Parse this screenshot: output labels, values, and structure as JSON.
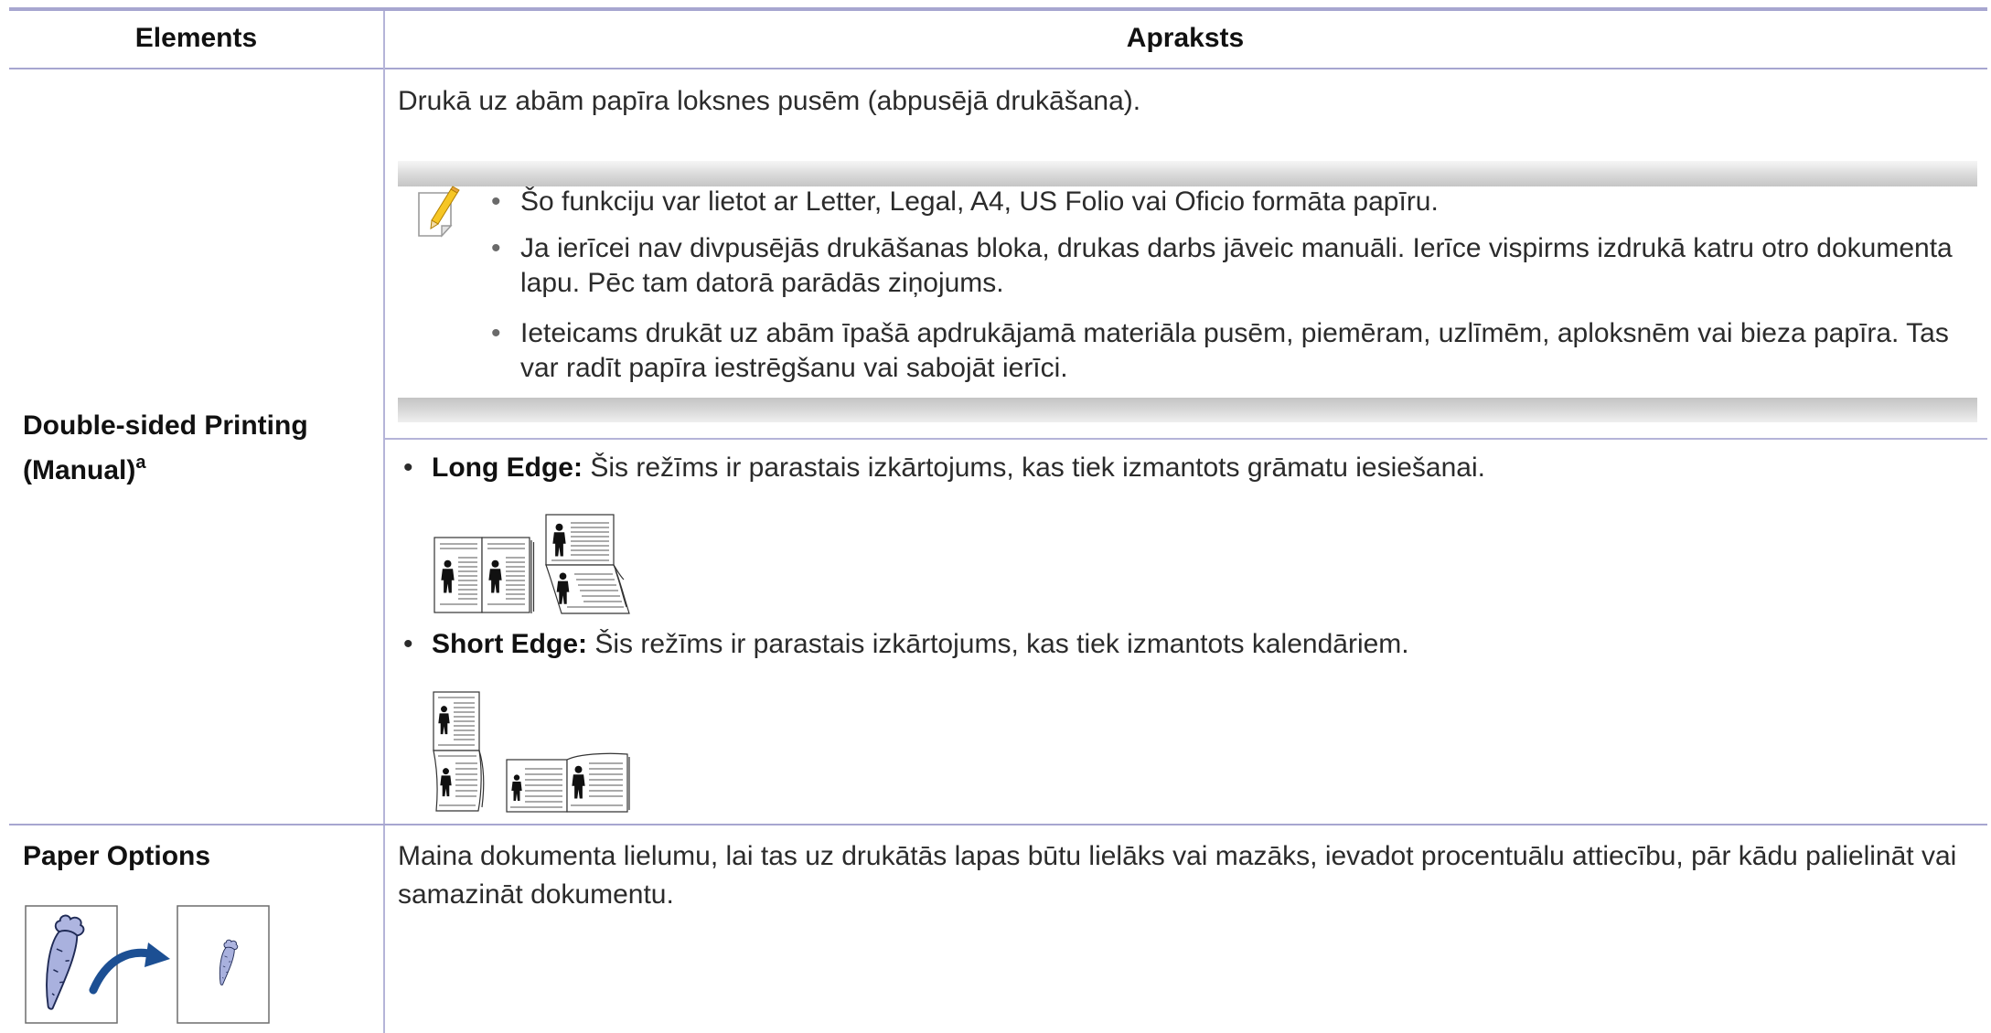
{
  "header": {
    "elements": "Elements",
    "description": "Apraksts"
  },
  "rows": {
    "double_sided": {
      "label": "Double-sided Printing (Manual)",
      "footnote_mark": "a",
      "description": "Drukā uz abām papīra loksnes pusēm (abpusējā drukāšana).",
      "note": {
        "icon": "note-pencil-icon",
        "bullets": [
          "Šo funkciju var lietot ar Letter, Legal, A4, US Folio vai Oficio formāta papīru.",
          "Ja ierīcei nav divpusējās drukāšanas bloka, drukas darbs jāveic manuāli. Ierīce vispirms izdrukā katru otro dokumenta lapu. Pēc tam datorā parādās ziņojums.",
          "Ieteicams drukāt uz abām īpašā apdrukājamā materiāla pusēm, piemēram, uzlīmēm, aploksnēm vai bieza papīra. Tas var radīt papīra iestrēgšanu vai sabojāt ierīci."
        ]
      },
      "options": [
        {
          "name": "Long Edge:",
          "text": "Šis režīms ir parastais izkārtojums, kas tiek izmantots grāmatu iesiešanai.",
          "icon": "long-edge-binding-icon"
        },
        {
          "name": "Short Edge:",
          "text": "Šis režīms ir parastais izkārtojums, kas tiek izmantots kalendāriem.",
          "icon": "short-edge-binding-icon"
        }
      ]
    },
    "paper_options": {
      "label": "Paper Options",
      "icon": "scale-document-icon",
      "description": "Maina dokumenta lielumu, lai tas uz drukātās lapas būtu lielāks vai mazāks, ievadot procentuālu attiecību, pār kādu palielināt vai samazināt dokumentu."
    }
  },
  "colors": {
    "rule": "#a7a6d0",
    "text": "#2b2b2b",
    "label": "#111111",
    "arrow": "#1c4f93",
    "carrot": "#a9b1de"
  }
}
